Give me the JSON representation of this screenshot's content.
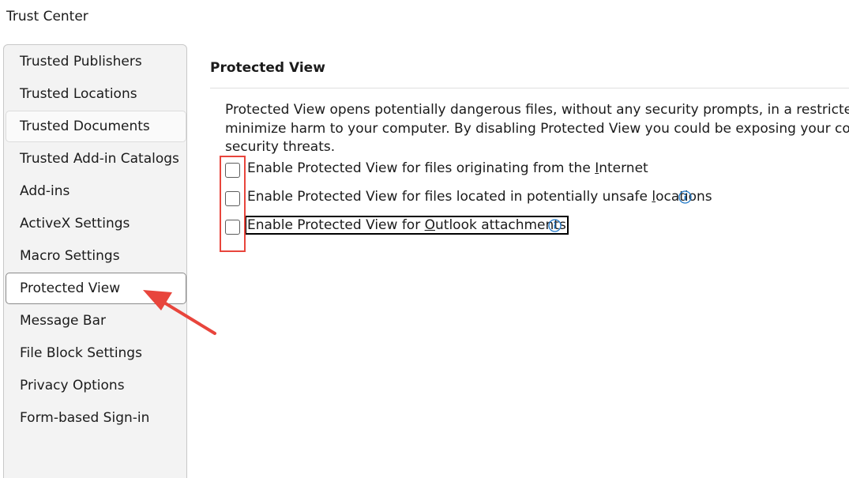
{
  "window": {
    "title": "Trust Center"
  },
  "sidebar": {
    "items": [
      {
        "label": "Trusted Publishers"
      },
      {
        "label": "Trusted Locations"
      },
      {
        "label": "Trusted Documents"
      },
      {
        "label": "Trusted Add-in Catalogs"
      },
      {
        "label": "Add-ins"
      },
      {
        "label": "ActiveX Settings"
      },
      {
        "label": "Macro Settings"
      },
      {
        "label": "Protected View"
      },
      {
        "label": "Message Bar"
      },
      {
        "label": "File Block Settings"
      },
      {
        "label": "Privacy Options"
      },
      {
        "label": "Form-based Sign-in"
      }
    ],
    "selected": "Protected View"
  },
  "main": {
    "section_title": "Protected View",
    "description_lines": [
      "Protected View opens potentially dangerous files, without any security prompts, in a restricted mode",
      "minimize harm to your computer. By disabling Protected View you could be exposing your computer",
      "security threats."
    ],
    "options": [
      {
        "label_pre": "Enable Protected View for files originating from the ",
        "label_key": "I",
        "label_post": "nternet",
        "checked": false
      },
      {
        "label_pre": "Enable Protected View for files located in potentially unsafe ",
        "label_key": "l",
        "label_post": "ocations",
        "checked": false,
        "info_icon": "info-circle-icon"
      },
      {
        "label_pre": "Enable Protected View for ",
        "label_key": "O",
        "label_post": "utlook attachments",
        "checked": false,
        "info_icon": "info-circle-icon"
      }
    ]
  },
  "colors": {
    "annotation_red": "#e8453c",
    "info_blue": "#1f78c8",
    "sidebar_bg": "#f3f3f3"
  }
}
